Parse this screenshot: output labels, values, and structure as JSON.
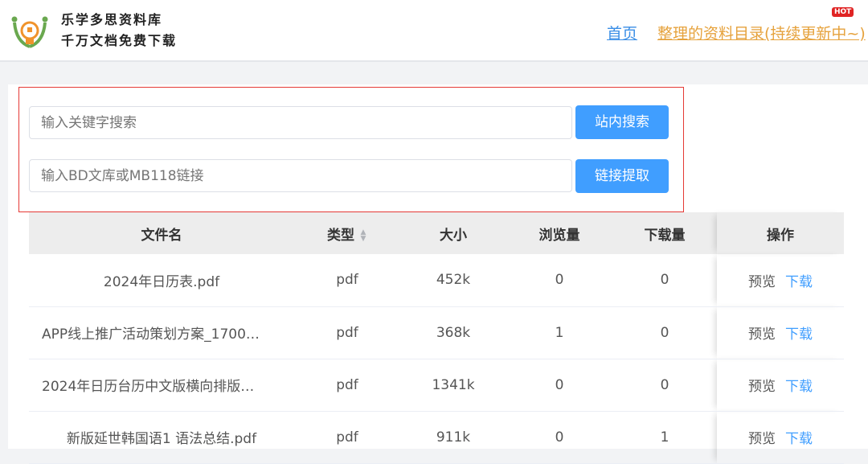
{
  "header": {
    "brand_line1": "乐学多思资料库",
    "brand_line2": "千万文档免费下载",
    "nav_home": "首页",
    "nav_directory": "整理的资料目录(持续更新中~)",
    "hot_badge": "HOT"
  },
  "search": {
    "keyword_placeholder": "输入关键字搜索",
    "keyword_button": "站内搜索",
    "link_placeholder": "输入BD文库或MB118链接",
    "link_button": "链接提取"
  },
  "table": {
    "headers": [
      "文件名",
      "类型",
      "大小",
      "浏览量",
      "下载量",
      "操作"
    ],
    "rows": [
      {
        "name": "2024年日历表.pdf",
        "type": "pdf",
        "size": "452k",
        "views": "0",
        "downloads": "0",
        "centered": true
      },
      {
        "name": "APP线上推广活动策划方案_1700…",
        "type": "pdf",
        "size": "368k",
        "views": "1",
        "downloads": "0",
        "centered": false
      },
      {
        "name": "2024年日历台历中文版横向排版…",
        "type": "pdf",
        "size": "1341k",
        "views": "0",
        "downloads": "0",
        "centered": false
      },
      {
        "name": "新版延世韩国语1 语法总结.pdf",
        "type": "pdf",
        "size": "911k",
        "views": "0",
        "downloads": "1",
        "centered": true
      }
    ],
    "preview_label": "预览",
    "download_label": "下载"
  }
}
